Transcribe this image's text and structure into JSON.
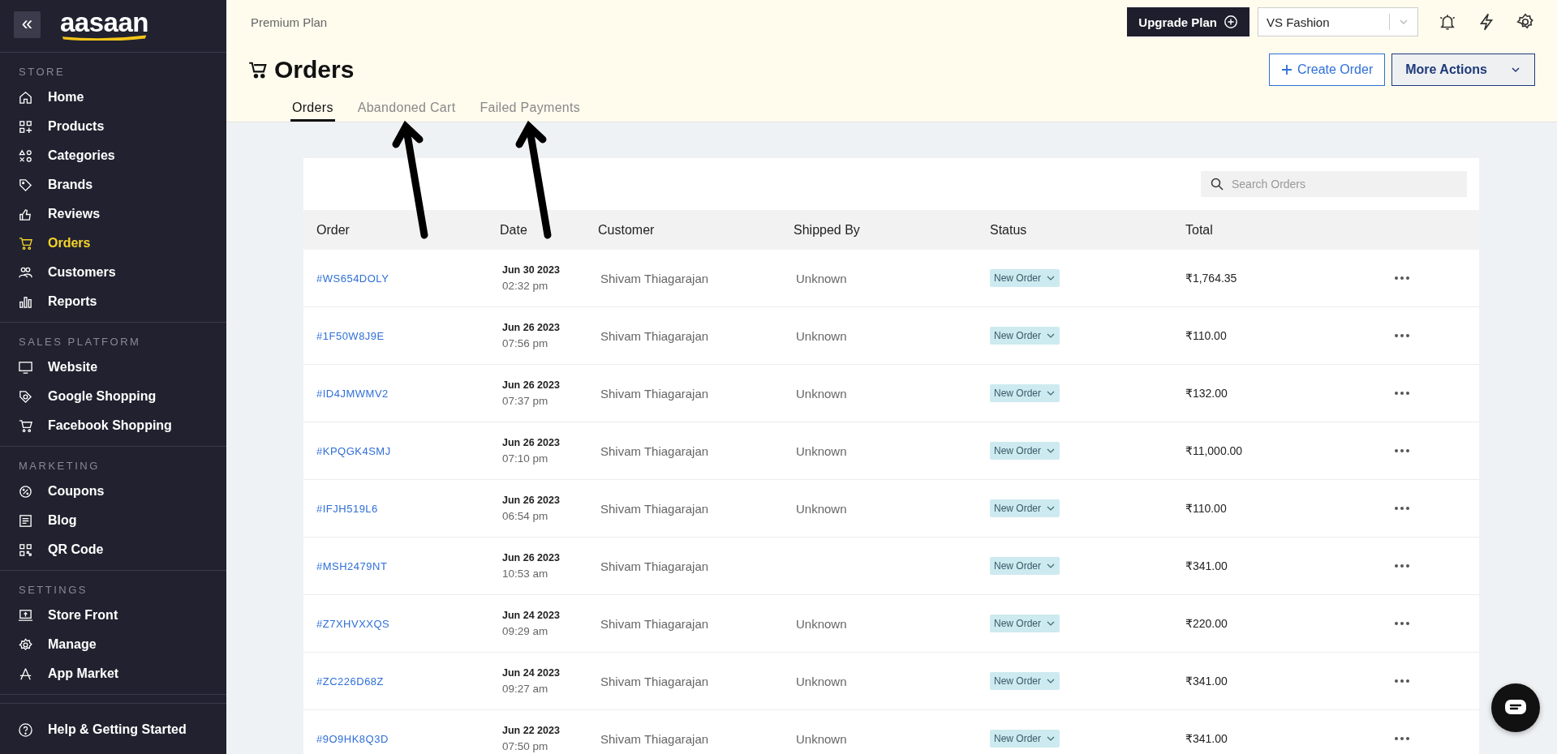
{
  "sidebar": {
    "logo": "aasaan",
    "collapse": "«",
    "sections": [
      {
        "title": "STORE",
        "items": [
          {
            "label": "Home",
            "selected": false
          },
          {
            "label": "Products",
            "selected": false
          },
          {
            "label": "Categories",
            "selected": false
          },
          {
            "label": "Brands",
            "selected": false
          },
          {
            "label": "Reviews",
            "selected": false
          },
          {
            "label": "Orders",
            "selected": true
          },
          {
            "label": "Customers",
            "selected": false
          },
          {
            "label": "Reports",
            "selected": false
          }
        ]
      },
      {
        "title": "SALES PLATFORM",
        "items": [
          {
            "label": "Website",
            "selected": false
          },
          {
            "label": "Google Shopping",
            "selected": false
          },
          {
            "label": "Facebook Shopping",
            "selected": false
          }
        ]
      },
      {
        "title": "MARKETING",
        "items": [
          {
            "label": "Coupons",
            "selected": false
          },
          {
            "label": "Blog",
            "selected": false
          },
          {
            "label": "QR Code",
            "selected": false
          }
        ]
      },
      {
        "title": "SETTINGS",
        "items": [
          {
            "label": "Store Front",
            "selected": false
          },
          {
            "label": "Manage",
            "selected": false
          },
          {
            "label": "App Market",
            "selected": false
          }
        ]
      }
    ],
    "help": "Help & Getting Started"
  },
  "header": {
    "plan": "Premium Plan",
    "upgrade_button": "Upgrade Plan",
    "store_select": "VS Fashion",
    "title": "Orders",
    "create_button": "Create Order",
    "more_button": "More Actions",
    "tabs": [
      {
        "label": "Orders",
        "selected": true,
        "pointed": false
      },
      {
        "label": "Abandoned Cart",
        "selected": false,
        "pointed": true
      },
      {
        "label": "Failed Payments",
        "selected": false,
        "pointed": true
      }
    ]
  },
  "search": {
    "placeholder": "Search Orders"
  },
  "table": {
    "columns": [
      "Order",
      "Date",
      "Customer",
      "Shipped By",
      "Status",
      "Total"
    ],
    "rows": [
      {
        "order": "#WS654DOLY",
        "date": "Jun 30 2023",
        "time": "02:32 pm",
        "customer": "Shivam Thiagarajan",
        "shipped_by": "Unknown",
        "status": "New Order",
        "total": "₹1,764.35"
      },
      {
        "order": "#1F50W8J9E",
        "date": "Jun 26 2023",
        "time": "07:56 pm",
        "customer": "Shivam Thiagarajan",
        "shipped_by": "Unknown",
        "status": "New Order",
        "total": "₹110.00"
      },
      {
        "order": "#ID4JMWMV2",
        "date": "Jun 26 2023",
        "time": "07:37 pm",
        "customer": "Shivam Thiagarajan",
        "shipped_by": "Unknown",
        "status": "New Order",
        "total": "₹132.00"
      },
      {
        "order": "#KPQGK4SMJ",
        "date": "Jun 26 2023",
        "time": "07:10 pm",
        "customer": "Shivam Thiagarajan",
        "shipped_by": "Unknown",
        "status": "New Order",
        "total": "₹11,000.00"
      },
      {
        "order": "#IFJH519L6",
        "date": "Jun 26 2023",
        "time": "06:54 pm",
        "customer": "Shivam Thiagarajan",
        "shipped_by": "Unknown",
        "status": "New Order",
        "total": "₹110.00"
      },
      {
        "order": "#MSH2479NT",
        "date": "Jun 26 2023",
        "time": "10:53 am",
        "customer": "Shivam Thiagarajan",
        "status": "New Order",
        "total": "₹341.00"
      },
      {
        "order": "#Z7XHVXXQS",
        "date": "Jun 24 2023",
        "time": "09:29 am",
        "customer": "Shivam Thiagarajan",
        "shipped_by": "Unknown",
        "status": "New Order",
        "total": "₹220.00"
      },
      {
        "order": "#ZC226D68Z",
        "date": "Jun 24 2023",
        "time": "09:27 am",
        "customer": "Shivam Thiagarajan",
        "shipped_by": "Unknown",
        "status": "New Order",
        "total": "₹341.00"
      },
      {
        "order": "#9O9HK8Q3D",
        "date": "Jun 22 2023",
        "time": "07:50 pm",
        "customer": "Shivam Thiagarajan",
        "shipped_by": "Unknown",
        "status": "New Order",
        "total": "₹341.00"
      }
    ]
  }
}
